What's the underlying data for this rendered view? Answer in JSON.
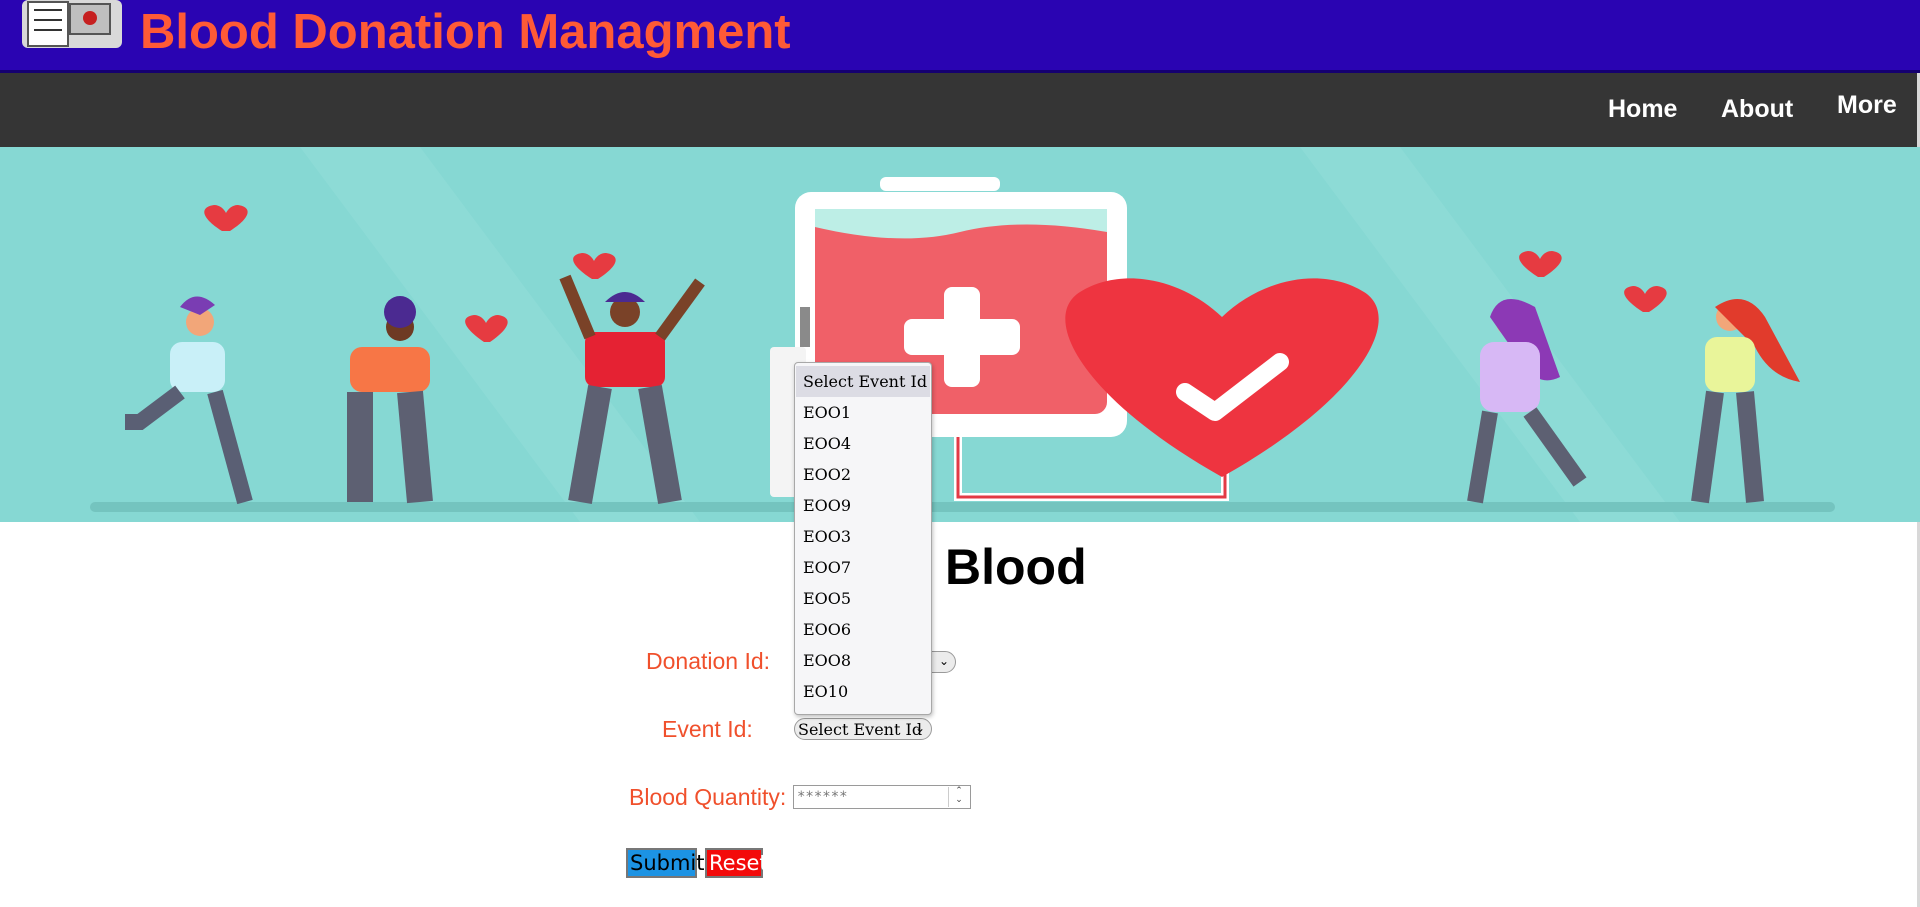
{
  "header": {
    "title": "Blood Donation Managment",
    "bg_color": "#2a04b2",
    "title_color": "#ff5a36"
  },
  "nav": {
    "items": [
      {
        "label": "Home"
      },
      {
        "label": "About"
      },
      {
        "label": "More"
      }
    ]
  },
  "form": {
    "title": "Blood",
    "donation_id_label": "Donation Id:",
    "event_id_label": "Event Id:",
    "event_id_value": "Select Event Id",
    "blood_quantity_label": "Blood Quantity:",
    "blood_quantity_placeholder": "******",
    "submit_label": "Submit",
    "reset_label": "Reset",
    "label_color": "#f0502c"
  },
  "event_dropdown": {
    "open": true,
    "options": [
      "Select Event Id",
      "EOO1",
      "EOO4",
      "EOO2",
      "EOO9",
      "EOO3",
      "EOO7",
      "EOO5",
      "EOO6",
      "EOO8",
      "EO10"
    ],
    "selected": "Select Event Id"
  }
}
